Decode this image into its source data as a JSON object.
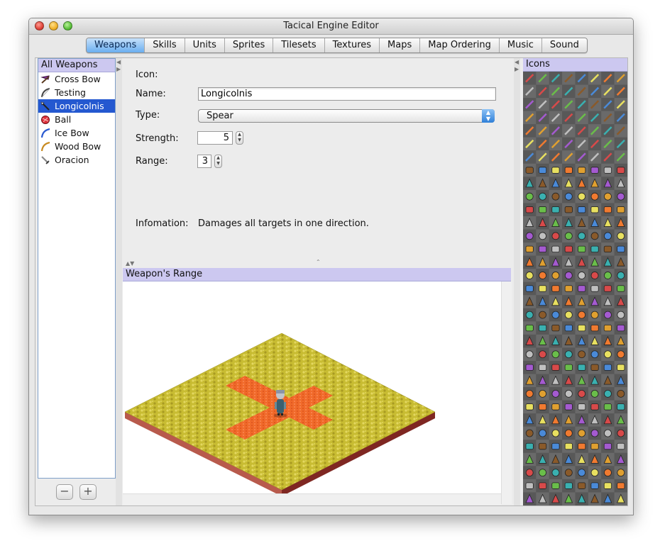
{
  "window": {
    "title": "Tacical Engine Editor"
  },
  "tabs": [
    {
      "label": "Weapons",
      "active": true
    },
    {
      "label": "Skills"
    },
    {
      "label": "Units"
    },
    {
      "label": "Sprites"
    },
    {
      "label": "Tilesets"
    },
    {
      "label": "Textures"
    },
    {
      "label": "Maps"
    },
    {
      "label": "Map Ordering"
    },
    {
      "label": "Music"
    },
    {
      "label": "Sound"
    }
  ],
  "weapons_panel": {
    "header": "All Weapons",
    "items": [
      {
        "label": "Cross Bow",
        "icon": "crossbow-icon"
      },
      {
        "label": "Testing",
        "icon": "bow-icon"
      },
      {
        "label": "Longicolnis",
        "icon": "spear-icon",
        "selected": true
      },
      {
        "label": "Ball",
        "icon": "ball-icon"
      },
      {
        "label": "Ice Bow",
        "icon": "ice-bow-icon"
      },
      {
        "label": "Wood Bow",
        "icon": "wood-bow-icon"
      },
      {
        "label": "Oracion",
        "icon": "sword-icon"
      }
    ],
    "remove_label": "−",
    "add_label": "+"
  },
  "form": {
    "icon_label": "Icon:",
    "name_label": "Name:",
    "name_value": "Longicolnis",
    "type_label": "Type:",
    "type_value": "Spear",
    "strength_label": "Strength:",
    "strength_value": "5",
    "range_label": "Range:",
    "range_value": "3",
    "info_label": "Infomation:",
    "info_value": "Damages all targets in one direction."
  },
  "range_panel": {
    "header": "Weapon's Range"
  },
  "icons_panel": {
    "header": "Icons"
  },
  "colors": {
    "selection": "#2458d0",
    "panel_header": "#ccc8f0",
    "tile_top": "#c8bc32",
    "tile_side_left": "#b85a4c",
    "tile_side_right": "#7f2722",
    "range_highlight": "#f06a2a"
  }
}
